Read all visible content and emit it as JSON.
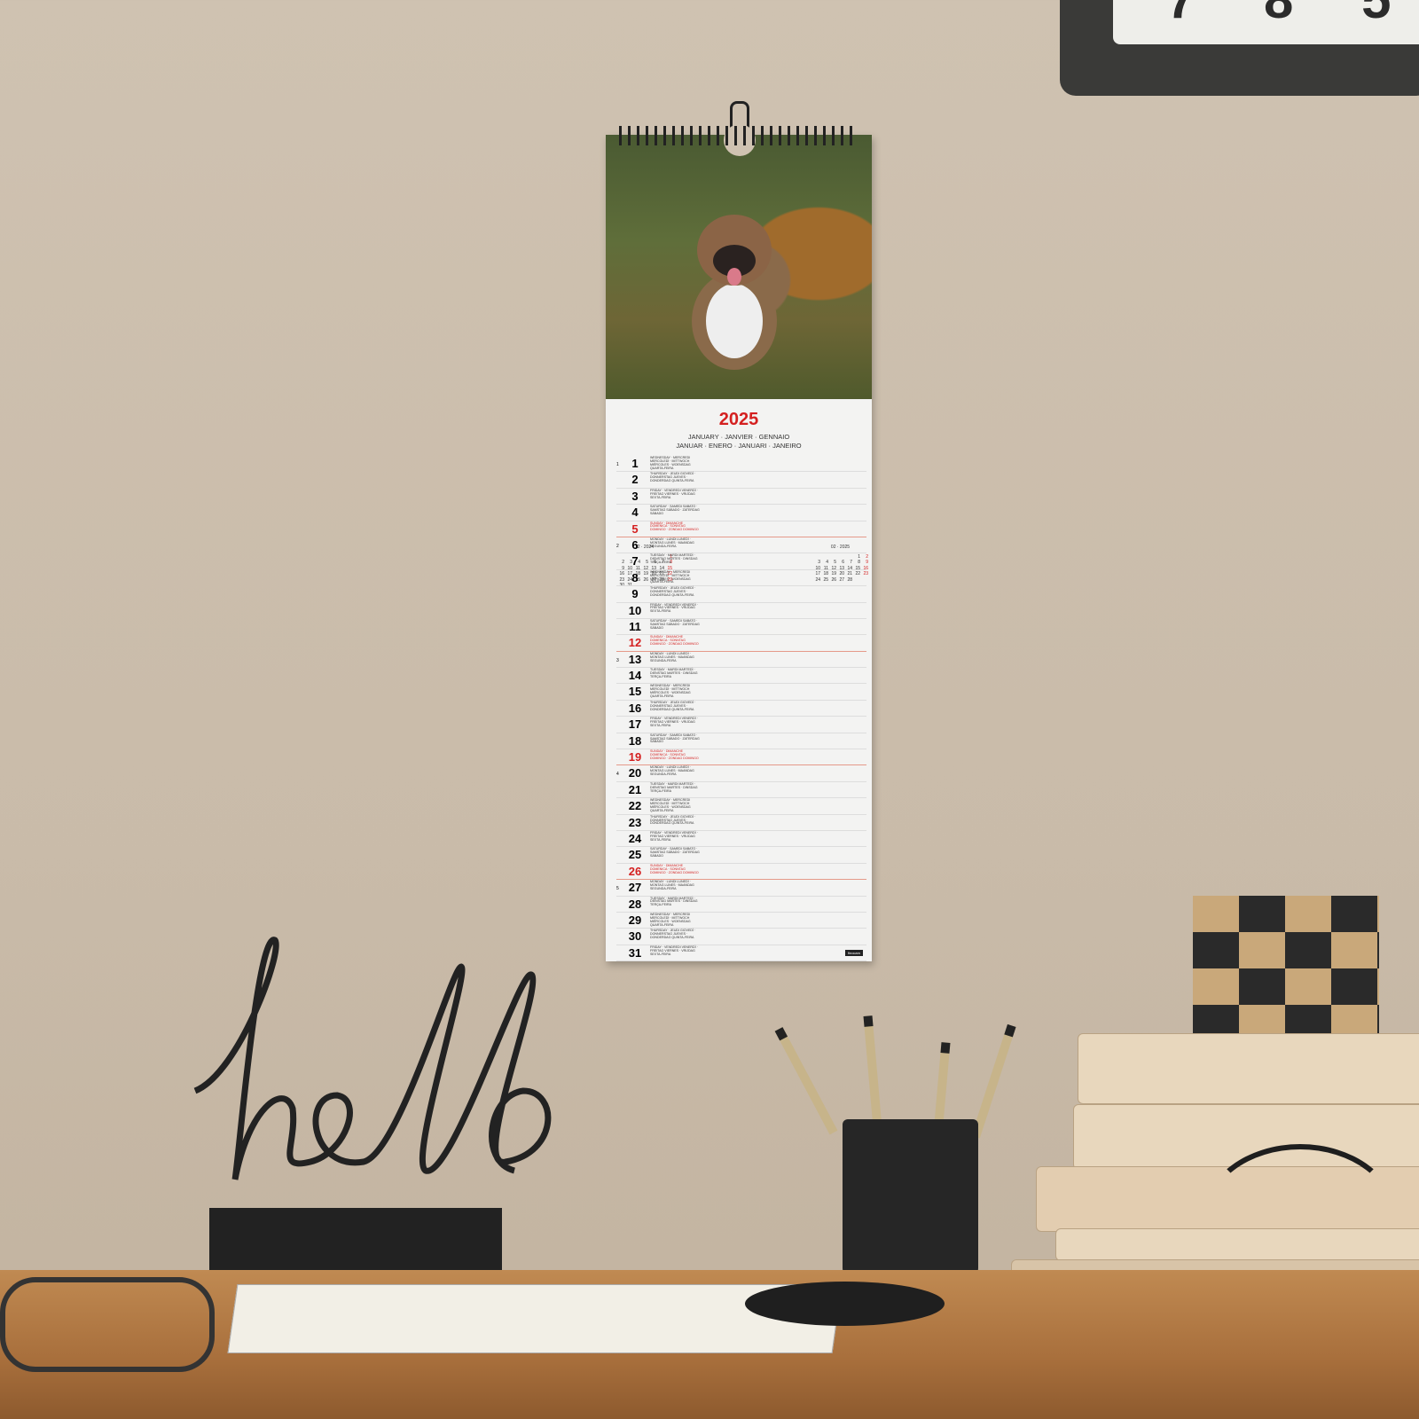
{
  "calendar": {
    "year": "2025",
    "month_line_1": "JANUARY · JANVIER · GENNAIO",
    "month_line_2": "JANUAR · ENERO · JANUARI · JANEIRO",
    "photo_caption": "English Bulldog",
    "accent_color": "#d42020",
    "prev_month": {
      "title": "12 · 2024",
      "rows": [
        [
          "",
          "",
          "",
          "",
          "",
          "",
          "1"
        ],
        [
          "2",
          "3",
          "4",
          "5",
          "6",
          "7",
          "8"
        ],
        [
          "9",
          "10",
          "11",
          "12",
          "13",
          "14",
          "15"
        ],
        [
          "16",
          "17",
          "18",
          "19",
          "20",
          "21",
          "22"
        ],
        [
          "23",
          "24",
          "25",
          "26",
          "27",
          "28",
          "29"
        ],
        [
          "30",
          "31",
          "",
          "",
          "",
          "",
          ""
        ]
      ]
    },
    "next_month": {
      "title": "02 · 2025",
      "rows": [
        [
          "",
          "",
          "",
          "",
          "",
          "1",
          "2"
        ],
        [
          "3",
          "4",
          "5",
          "6",
          "7",
          "8",
          "9"
        ],
        [
          "10",
          "11",
          "12",
          "13",
          "14",
          "15",
          "16"
        ],
        [
          "17",
          "18",
          "19",
          "20",
          "21",
          "22",
          "23"
        ],
        [
          "24",
          "25",
          "26",
          "27",
          "28",
          "",
          ""
        ]
      ]
    },
    "weekdays": {
      "mon": "MONDAY · LUNDI LUNEDÌ · MONTAG LUNES · MAANDAG SEGUNDA-FEIRA",
      "tue": "TUESDAY · MARDI MARTEDÌ · DIENSTAG MARTES · DINSDAG TERÇA-FEIRA",
      "wed": "WEDNESDAY · MERCREDI MERCOLEDÌ · MITTWOCH MIÉRCOLES · WOENSDAG QUARTA-FEIRA",
      "thu": "THURSDAY · JEUDI GIOVEDÌ · DONNERSTAG JUEVES · DONDERDAG QUINTA-FEIRA",
      "fri": "FRIDAY · VENDREDI VENERDÌ · FREITAG VIERNES · VRIJDAG SEXTA-FEIRA",
      "sat": "SATURDAY · SAMEDI SABATO · SAMSTAG SÁBADO · ZATERDAG SÁBADO",
      "sun": "SUNDAY · DIMANCHE DOMENICA · SONNTAG DOMINGO · ZONDAG DOMINGO"
    },
    "days": [
      {
        "n": "1",
        "wd": "wed",
        "wk": "1"
      },
      {
        "n": "2",
        "wd": "thu"
      },
      {
        "n": "3",
        "wd": "fri"
      },
      {
        "n": "4",
        "wd": "sat"
      },
      {
        "n": "5",
        "wd": "sun"
      },
      {
        "n": "6",
        "wd": "mon",
        "wk": "2"
      },
      {
        "n": "7",
        "wd": "tue"
      },
      {
        "n": "8",
        "wd": "wed"
      },
      {
        "n": "9",
        "wd": "thu"
      },
      {
        "n": "10",
        "wd": "fri"
      },
      {
        "n": "11",
        "wd": "sat"
      },
      {
        "n": "12",
        "wd": "sun"
      },
      {
        "n": "13",
        "wd": "mon",
        "wk": "3"
      },
      {
        "n": "14",
        "wd": "tue"
      },
      {
        "n": "15",
        "wd": "wed"
      },
      {
        "n": "16",
        "wd": "thu"
      },
      {
        "n": "17",
        "wd": "fri"
      },
      {
        "n": "18",
        "wd": "sat"
      },
      {
        "n": "19",
        "wd": "sun"
      },
      {
        "n": "20",
        "wd": "mon",
        "wk": "4"
      },
      {
        "n": "21",
        "wd": "tue"
      },
      {
        "n": "22",
        "wd": "wed"
      },
      {
        "n": "23",
        "wd": "thu"
      },
      {
        "n": "24",
        "wd": "fri"
      },
      {
        "n": "25",
        "wd": "sat"
      },
      {
        "n": "26",
        "wd": "sun"
      },
      {
        "n": "27",
        "wd": "mon",
        "wk": "5"
      },
      {
        "n": "28",
        "wd": "tue"
      },
      {
        "n": "29",
        "wd": "wed"
      },
      {
        "n": "30",
        "wd": "thu"
      },
      {
        "n": "31",
        "wd": "fri"
      }
    ],
    "brand": "finocam"
  },
  "clock": {
    "digits": "7 8 5"
  },
  "desk_decor": {
    "hello_sign": "hello"
  }
}
